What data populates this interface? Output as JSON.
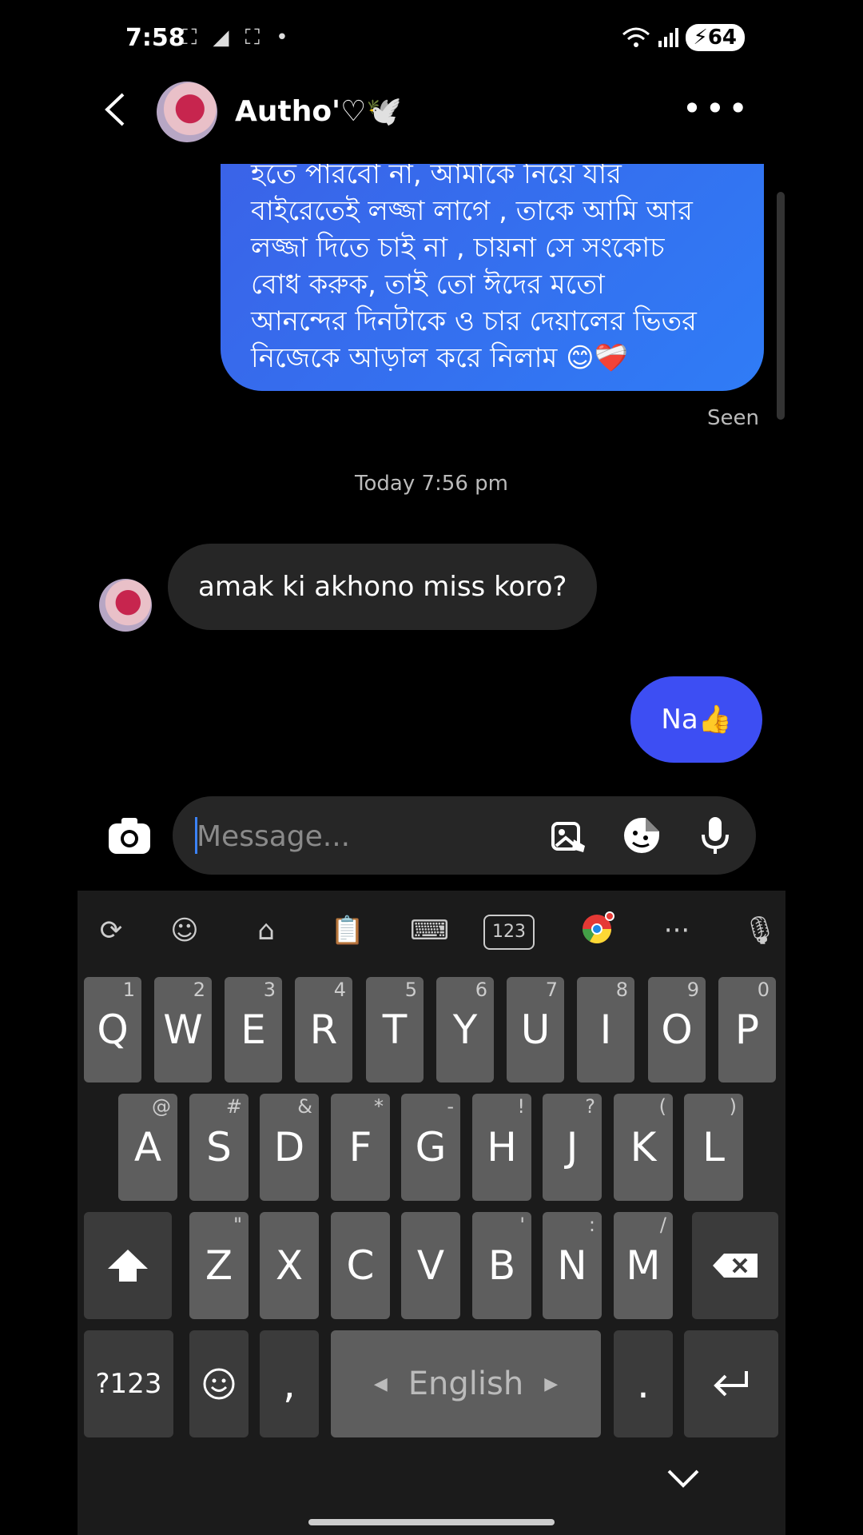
{
  "status_bar": {
    "time": "7:58",
    "battery": "64"
  },
  "header": {
    "contact_name": "Autho'♡🕊️"
  },
  "messages": {
    "outgoing_long_lines": [
      "হতে পারবো না,  আমাকে নিয়ে যার",
      "বাইরেতেই লজ্জা লাগে , তাকে আমি আর",
      "লজ্জা দিতে চাই না , চায়না সে সংকোচ",
      "বোধ করুক,  তাই তো ঈদের মতো",
      "আনন্দের দিনটাকে ও চার দেয়ালের ভিতর",
      "নিজেকে আড়াল করে নিলাম 😊❤️‍🩹"
    ],
    "seen_label": "Seen",
    "timestamp": "Today 7:56 pm",
    "incoming": "amak ki akhono miss koro?",
    "outgoing_short": "Na👍"
  },
  "composer": {
    "placeholder": "Message..."
  },
  "keyboard": {
    "row1": [
      {
        "k": "Q",
        "h": "1"
      },
      {
        "k": "W",
        "h": "2"
      },
      {
        "k": "E",
        "h": "3"
      },
      {
        "k": "R",
        "h": "4"
      },
      {
        "k": "T",
        "h": "5"
      },
      {
        "k": "Y",
        "h": "6"
      },
      {
        "k": "U",
        "h": "7"
      },
      {
        "k": "I",
        "h": "8"
      },
      {
        "k": "O",
        "h": "9"
      },
      {
        "k": "P",
        "h": "0"
      }
    ],
    "row2": [
      {
        "k": "A",
        "h": "@"
      },
      {
        "k": "S",
        "h": "#"
      },
      {
        "k": "D",
        "h": "&"
      },
      {
        "k": "F",
        "h": "*"
      },
      {
        "k": "G",
        "h": "-"
      },
      {
        "k": "H",
        "h": "!"
      },
      {
        "k": "J",
        "h": "?"
      },
      {
        "k": "K",
        "h": "("
      },
      {
        "k": "L",
        "h": ")"
      }
    ],
    "row3": [
      {
        "k": "Z",
        "h": "\""
      },
      {
        "k": "X",
        "h": ""
      },
      {
        "k": "C",
        "h": ""
      },
      {
        "k": "V",
        "h": ""
      },
      {
        "k": "B",
        "h": "'"
      },
      {
        "k": "N",
        "h": ":"
      },
      {
        "k": "M",
        "h": "/"
      }
    ],
    "sym_label": "?123",
    "comma": ",",
    "space_label": "English",
    "period": ".",
    "toolbar_123": "123"
  }
}
